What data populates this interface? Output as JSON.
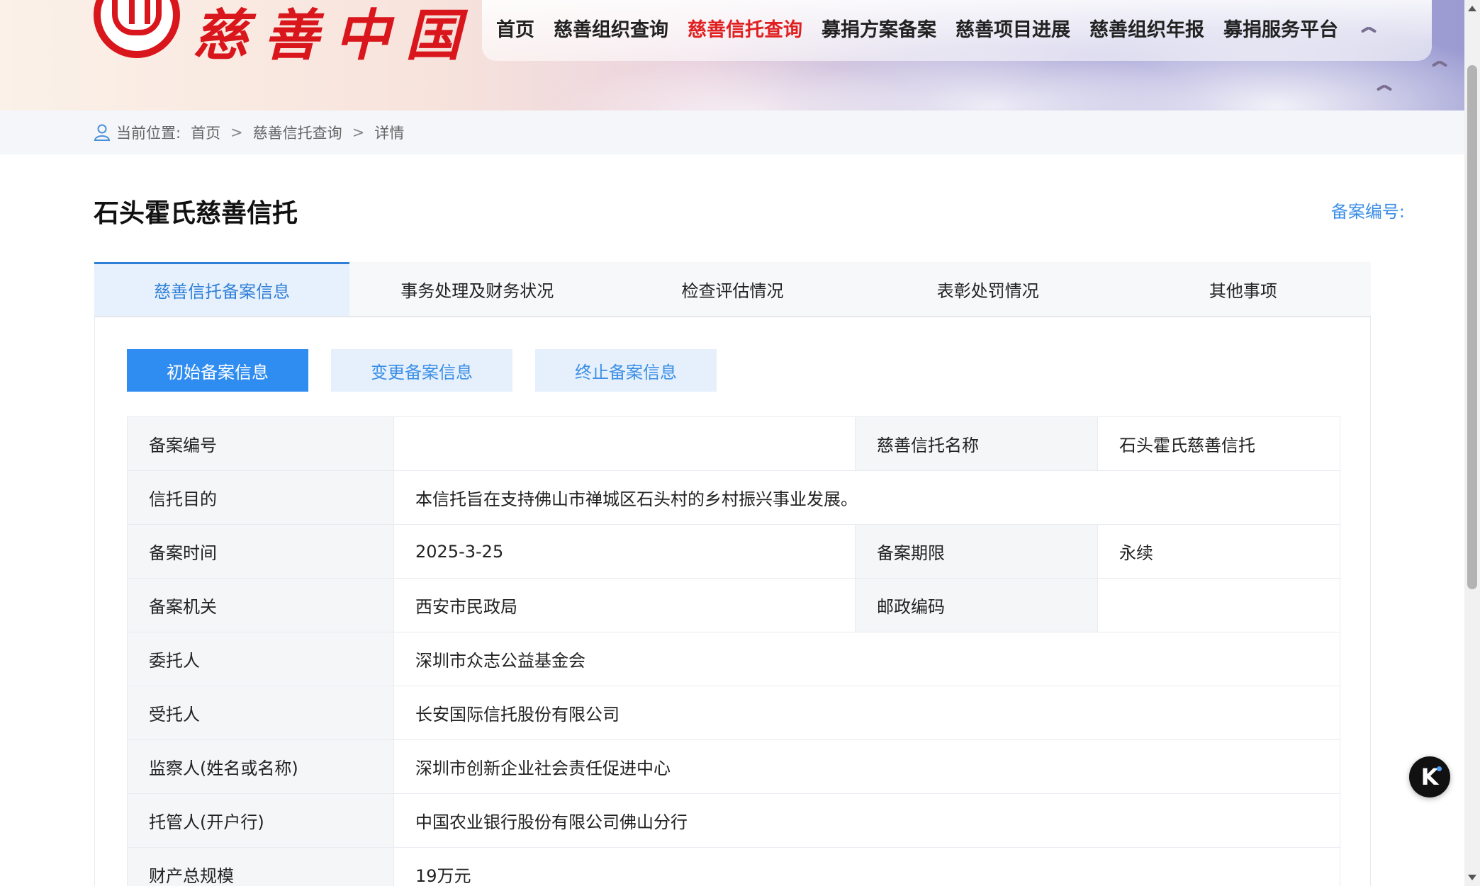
{
  "header": {
    "logo_text": "慈善中国",
    "nav": [
      {
        "label": "首页",
        "active": false
      },
      {
        "label": "慈善组织查询",
        "active": false
      },
      {
        "label": "慈善信托查询",
        "active": true
      },
      {
        "label": "募捐方案备案",
        "active": false
      },
      {
        "label": "慈善项目进展",
        "active": false
      },
      {
        "label": "慈善组织年报",
        "active": false
      },
      {
        "label": "募捐服务平台",
        "active": false
      }
    ]
  },
  "breadcrumb": {
    "prefix": "当前位置:",
    "items": [
      "首页",
      "慈善信托查询",
      "详情"
    ],
    "separator": ">"
  },
  "page": {
    "title": "石头霍氏慈善信托",
    "record_no_label": "备案编号:"
  },
  "main_tabs": [
    {
      "label": "慈善信托备案信息",
      "active": true
    },
    {
      "label": "事务处理及财务状况",
      "active": false
    },
    {
      "label": "检查评估情况",
      "active": false
    },
    {
      "label": "表彰处罚情况",
      "active": false
    },
    {
      "label": "其他事项",
      "active": false
    }
  ],
  "sub_tabs": [
    {
      "label": "初始备案信息",
      "active": true
    },
    {
      "label": "变更备案信息",
      "active": false
    },
    {
      "label": "终止备案信息",
      "active": false
    }
  ],
  "info_table": {
    "record_no": {
      "label": "备案编号",
      "value": ""
    },
    "trust_name": {
      "label": "慈善信托名称",
      "value": "石头霍氏慈善信托"
    },
    "purpose": {
      "label": "信托目的",
      "value": "本信托旨在支持佛山市禅城区石头村的乡村振兴事业发展。"
    },
    "record_time": {
      "label": "备案时间",
      "value": "2025-3-25"
    },
    "record_term": {
      "label": "备案期限",
      "value": "永续"
    },
    "authority": {
      "label": "备案机关",
      "value": "西安市民政局"
    },
    "postcode": {
      "label": "邮政编码",
      "value": ""
    },
    "settlor": {
      "label": "委托人",
      "value": "深圳市众志公益基金会"
    },
    "trustee": {
      "label": "受托人",
      "value": "长安国际信托股份有限公司"
    },
    "supervisor": {
      "label": "监察人(姓名或名称)",
      "value": "深圳市创新企业社会责任促进中心"
    },
    "custodian": {
      "label": "托管人(开户行)",
      "value": "中国农业银行股份有限公司佛山分行"
    },
    "total_assets": {
      "label": "财产总规模",
      "value": "19万元"
    }
  },
  "colors": {
    "accent": "#2f8cf0",
    "link": "#3a8ee6",
    "nav_active": "#e02020",
    "logo_red": "#d9161c"
  },
  "floating": {
    "k_button": "K"
  }
}
